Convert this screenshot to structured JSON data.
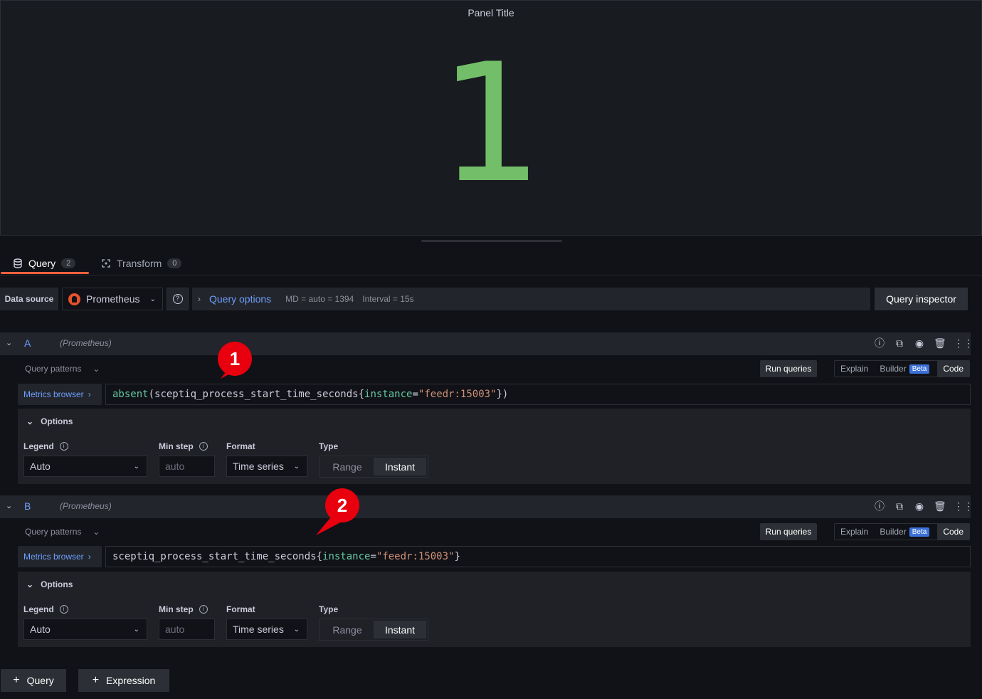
{
  "panel": {
    "title": "Panel Title",
    "value": "1",
    "value_color": "#73bf69"
  },
  "tabs": [
    {
      "label": "Query",
      "count": "2"
    },
    {
      "label": "Transform",
      "count": "0"
    }
  ],
  "datasource": {
    "label": "Data source",
    "selected": "Prometheus",
    "query_options_label": "Query options",
    "md": "MD = auto = 1394",
    "interval": "Interval = 15s",
    "inspector_label": "Query inspector"
  },
  "queries": [
    {
      "letter": "A",
      "datasource": "(Prometheus)",
      "patterns_label": "Query patterns",
      "run_label": "Run queries",
      "modes": {
        "explain": "Explain",
        "builder": "Builder",
        "beta": "Beta",
        "code": "Code"
      },
      "metrics_browser": "Metrics browser",
      "expr": {
        "fn": "absent",
        "open": "(",
        "metric": "sceptiq_process_start_time_seconds{",
        "label": "instance",
        "eq": "=",
        "value": "\"feedr:15003\"",
        "close": "})"
      },
      "options": {
        "title": "Options",
        "legend_label": "Legend",
        "legend_value": "Auto",
        "minstep_label": "Min step",
        "minstep_placeholder": "auto",
        "format_label": "Format",
        "format_value": "Time series",
        "type_label": "Type",
        "type_range": "Range",
        "type_instant": "Instant"
      }
    },
    {
      "letter": "B",
      "datasource": "(Prometheus)",
      "patterns_label": "Query patterns",
      "run_label": "Run queries",
      "modes": {
        "explain": "Explain",
        "builder": "Builder",
        "beta": "Beta",
        "code": "Code"
      },
      "metrics_browser": "Metrics browser",
      "expr": {
        "metric": "sceptiq_process_start_time_seconds{",
        "label": "instance",
        "eq": "=",
        "value": "\"feedr:15003\"",
        "close": "}"
      },
      "options": {
        "title": "Options",
        "legend_label": "Legend",
        "legend_value": "Auto",
        "minstep_label": "Min step",
        "minstep_placeholder": "auto",
        "format_label": "Format",
        "format_value": "Time series",
        "type_label": "Type",
        "type_range": "Range",
        "type_instant": "Instant"
      }
    }
  ],
  "callouts": [
    "1",
    "2"
  ],
  "footer": {
    "add_query": "Query",
    "add_expression": "Expression"
  },
  "icons": {
    "tab_query": "database-icon",
    "tab_transform": "transform-icon",
    "row_actions": [
      "help-icon",
      "duplicate-icon",
      "eye-icon",
      "trash-icon",
      "drag-handle-icon"
    ]
  },
  "colors": {
    "accent": "#6e9fff",
    "tab_underline": "#f55f3e",
    "callout": "#e8000e",
    "prometheus": "#e6522c"
  }
}
